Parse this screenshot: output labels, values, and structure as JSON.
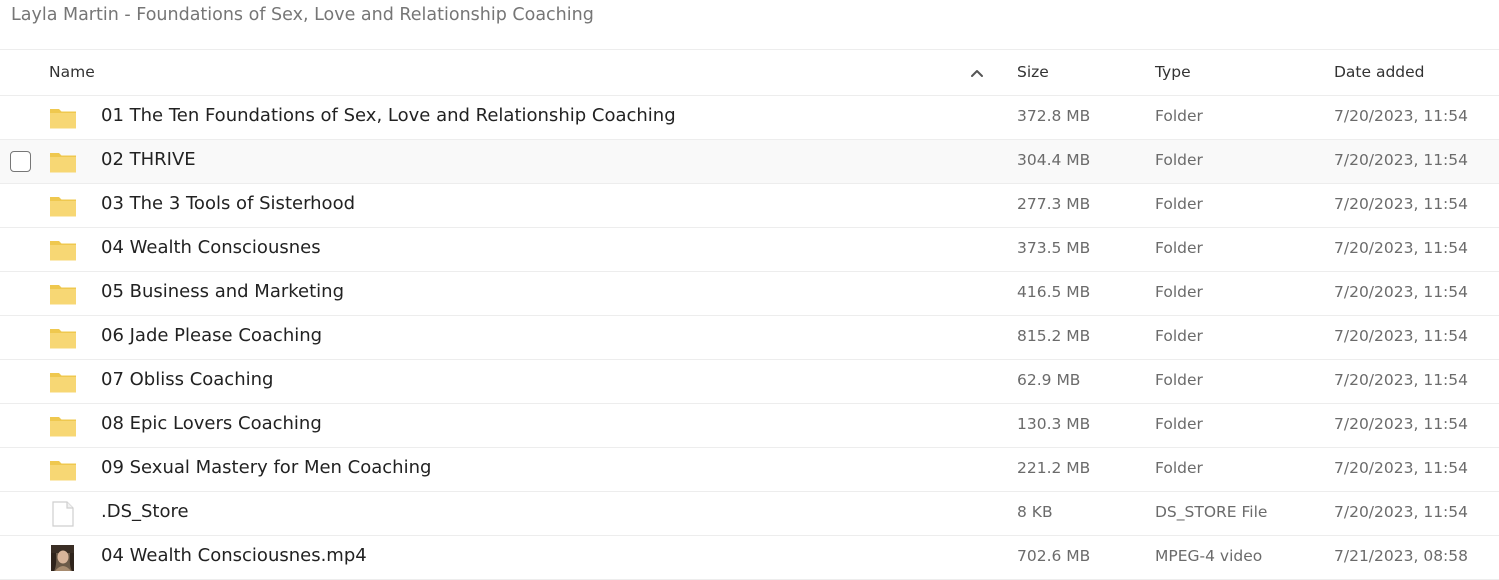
{
  "breadcrumb": "Layla Martin - Foundations of Sex, Love and Relationship Coaching",
  "columns": {
    "name": "Name",
    "size": "Size",
    "type": "Type",
    "date": "Date added"
  },
  "sort_icon": "chevron-up-icon",
  "colors": {
    "folder": "#f7d774",
    "folder_tab": "#efc84f",
    "divider": "#ededed",
    "hover_row": "#f9f9f9"
  },
  "rows": [
    {
      "icon": "folder-icon",
      "name": "01 The Ten Foundations of Sex, Love and Relationship Coaching",
      "size": "372.8 MB",
      "type": "Folder",
      "date": "7/20/2023, 11:54"
    },
    {
      "icon": "folder-icon",
      "name": "02 THRIVE",
      "size": "304.4 MB",
      "type": "Folder",
      "date": "7/20/2023, 11:54",
      "hovered": true
    },
    {
      "icon": "folder-icon",
      "name": "03 The 3 Tools of Sisterhood",
      "size": "277.3 MB",
      "type": "Folder",
      "date": "7/20/2023, 11:54"
    },
    {
      "icon": "folder-icon",
      "name": "04 Wealth Consciousnes",
      "size": "373.5 MB",
      "type": "Folder",
      "date": "7/20/2023, 11:54"
    },
    {
      "icon": "folder-icon",
      "name": "05 Business and Marketing",
      "size": "416.5 MB",
      "type": "Folder",
      "date": "7/20/2023, 11:54"
    },
    {
      "icon": "folder-icon",
      "name": "06 Jade Please Coaching",
      "size": "815.2 MB",
      "type": "Folder",
      "date": "7/20/2023, 11:54"
    },
    {
      "icon": "folder-icon",
      "name": "07 Obliss Coaching",
      "size": "62.9 MB",
      "type": "Folder",
      "date": "7/20/2023, 11:54"
    },
    {
      "icon": "folder-icon",
      "name": "08 Epic Lovers Coaching",
      "size": "130.3 MB",
      "type": "Folder",
      "date": "7/20/2023, 11:54"
    },
    {
      "icon": "folder-icon",
      "name": "09 Sexual Mastery for Men Coaching",
      "size": "221.2 MB",
      "type": "Folder",
      "date": "7/20/2023, 11:54"
    },
    {
      "icon": "file-icon",
      "name": ".DS_Store",
      "size": "8 KB",
      "type": "DS_STORE File",
      "date": "7/20/2023, 11:54"
    },
    {
      "icon": "video-thumbnail-icon",
      "name": "04 Wealth Consciousnes.mp4",
      "size": "702.6 MB",
      "type": "MPEG-4 video",
      "date": "7/21/2023, 08:58"
    }
  ]
}
